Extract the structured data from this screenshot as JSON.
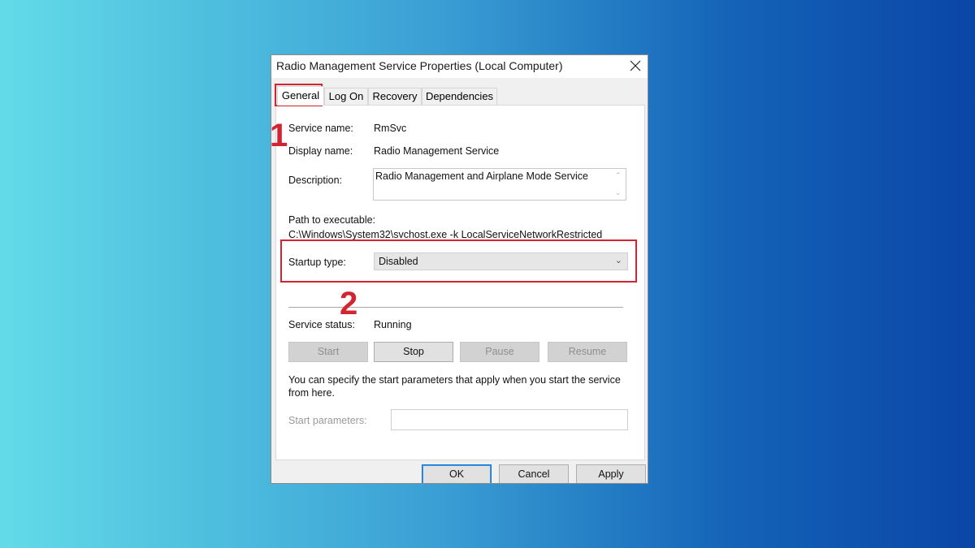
{
  "window": {
    "title": "Radio Management Service Properties (Local Computer)",
    "close_icon": "close-icon"
  },
  "tabs": [
    {
      "label": "General",
      "active": true
    },
    {
      "label": "Log On",
      "active": false
    },
    {
      "label": "Recovery",
      "active": false
    },
    {
      "label": "Dependencies",
      "active": false
    }
  ],
  "general": {
    "service_name_label": "Service name:",
    "service_name_value": "RmSvc",
    "display_name_label": "Display name:",
    "display_name_value": "Radio Management Service",
    "description_label": "Description:",
    "description_value": "Radio Management and Airplane Mode Service",
    "path_label": "Path to executable:",
    "path_value": "C:\\Windows\\System32\\svchost.exe -k LocalServiceNetworkRestricted",
    "startup_type_label": "Startup type:",
    "startup_type_value": "Disabled",
    "service_status_label": "Service status:",
    "service_status_value": "Running",
    "buttons": {
      "start": "Start",
      "stop": "Stop",
      "pause": "Pause",
      "resume": "Resume"
    },
    "hint": "You can specify the start parameters that apply when you start the service",
    "hint_line2": "from here.",
    "start_params_label": "Start parameters:",
    "start_params_value": ""
  },
  "footer": {
    "ok": "OK",
    "cancel": "Cancel",
    "apply": "Apply"
  },
  "annotations": {
    "marker_1": "1",
    "marker_2": "2",
    "highlight_color": "#d32431"
  }
}
